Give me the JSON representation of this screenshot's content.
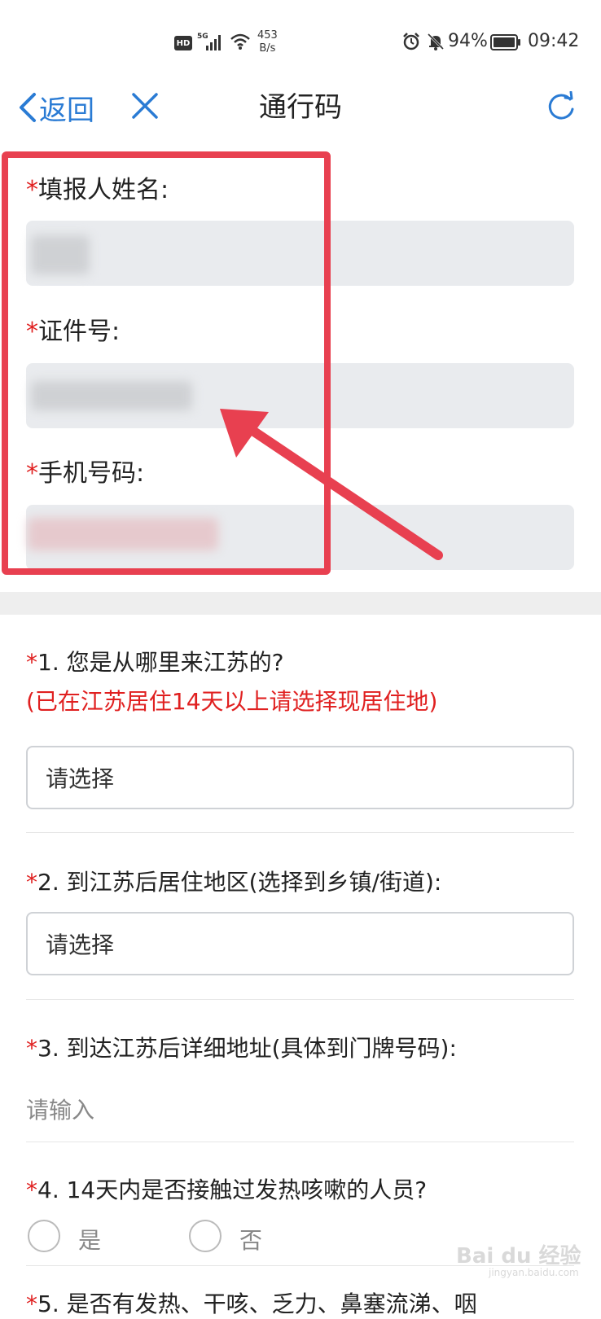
{
  "status_bar": {
    "hd": "HD",
    "network": "5G",
    "speed_value": "453",
    "speed_unit": "B/s",
    "battery": "94%",
    "time": "09:42"
  },
  "nav": {
    "back_label": "返回",
    "title": "通行码"
  },
  "personal": {
    "name_label": "填报人姓名:",
    "id_label": "证件号:",
    "phone_label": "手机号码:",
    "required_mark": "*"
  },
  "questions": [
    {
      "label": "1. 您是从哪里来江苏的?",
      "note": "(已在江苏居住14天以上请选择现居住地)",
      "value": "请选择"
    },
    {
      "label": "2. 到江苏后居住地区(选择到乡镇/街道):",
      "value": "请选择"
    },
    {
      "label": "3. 到达江苏后详细地址(具体到门牌号码):",
      "placeholder": "请输入"
    },
    {
      "label": "4. 14天内是否接触过发热咳嗽的人员?",
      "options": [
        "是",
        "否"
      ]
    },
    {
      "label": "5. 是否有发热、干咳、乏力、鼻塞流涕、咽"
    }
  ],
  "watermark": {
    "brand": "Bai du 经验",
    "url": "jingyan.baidu.com"
  },
  "colors": {
    "accent": "#2a7bd4",
    "required": "#e02020",
    "highlight": "#e84050"
  }
}
